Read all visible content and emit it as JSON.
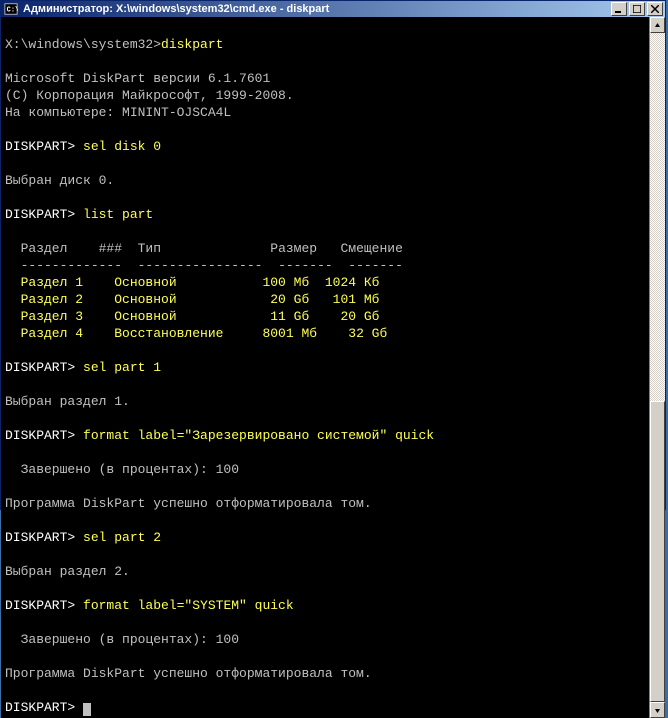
{
  "titlebar": {
    "text": "Администратор: X:\\windows\\system32\\cmd.exe - diskpart"
  },
  "prompt_path": "X:\\windows\\system32>",
  "cmd_diskpart": "diskpart",
  "diskpart_header": {
    "line1": "Microsoft DiskPart версии 6.1.7601",
    "line2": "(C) Корпорация Майкрософт, 1999-2008.",
    "line3": "На компьютере: MININT-OJSCA4L"
  },
  "prompt_dp": "DISKPART> ",
  "cmd_sel_disk": "sel disk 0",
  "msg_disk_selected": "Выбран диск 0.",
  "cmd_list_part": "list part",
  "table": {
    "header": {
      "part": "  Раздел",
      "hash": "    ###",
      "type": "  Тип",
      "size": "              Размер",
      "offset": "   Смещение"
    },
    "divider": {
      "part": "  -------------",
      "type": "  ----------------",
      "size": "  -------",
      "offset": "  -------"
    },
    "rows": [
      {
        "part": "  Раздел 1",
        "type": "    Основной",
        "size": "           100 Мб",
        "offset": "  1024 Кб"
      },
      {
        "part": "  Раздел 2",
        "type": "    Основной",
        "size": "            20 Gб",
        "offset": "   101 Мб"
      },
      {
        "part": "  Раздел 3",
        "type": "    Основной",
        "size": "            11 Gб",
        "offset": "    20 Gб"
      },
      {
        "part": "  Раздел 4",
        "type": "    Восстановление",
        "size": "     8001 Мб",
        "offset": "    32 Gб"
      }
    ]
  },
  "cmd_sel_part1": "sel part 1",
  "msg_part1_selected": "Выбран раздел 1.",
  "cmd_format1": "format label=\"Зарезервировано системой\" quick",
  "msg_progress1": "  Завершено (в процентах): 100",
  "msg_format_ok1": "Программа DiskPart успешно отформатировала том.",
  "cmd_sel_part2": "sel part 2",
  "msg_part2_selected": "Выбран раздел 2.",
  "cmd_format2": "format label=\"SYSTEM\" quick",
  "msg_progress2": "  Завершено (в процентах): 100",
  "msg_format_ok2": "Программа DiskPart успешно отформатировала том."
}
